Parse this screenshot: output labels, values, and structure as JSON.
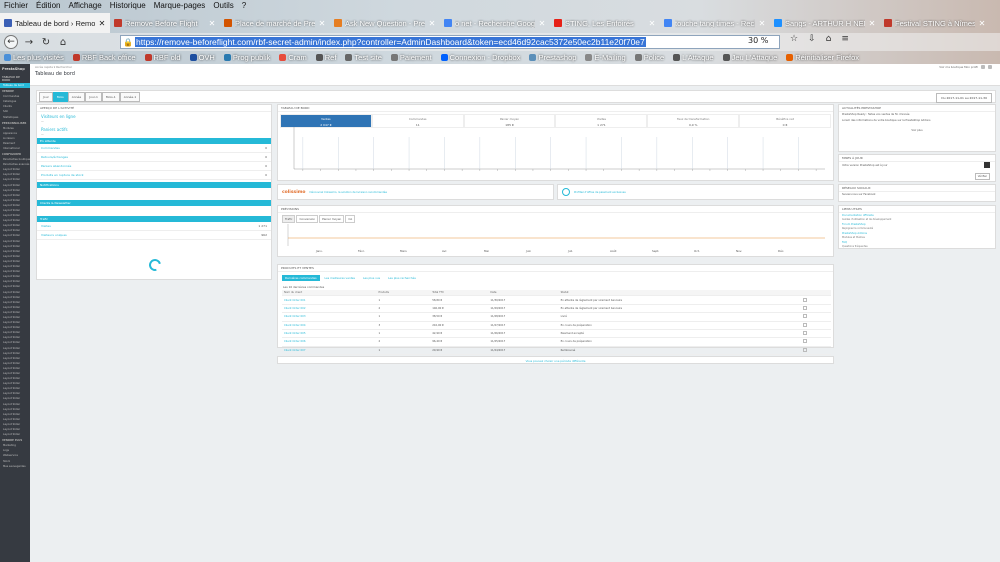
{
  "browser": {
    "menu": [
      "Fichier",
      "Édition",
      "Affichage",
      "Historique",
      "Marque-pages",
      "Outils",
      "?"
    ],
    "tabs": [
      {
        "title": "Tableau de bord › Remove",
        "color": "#3b5fb5",
        "active": true
      },
      {
        "title": "Remove Before Flight",
        "color": "#c0392b",
        "active": false
      },
      {
        "title": "Place de marché de Presta",
        "color": "#d35400",
        "active": false
      },
      {
        "title": "Ask New Question - Presta",
        "color": "#e67e22",
        "active": false
      },
      {
        "title": "o net - Recherche Google",
        "color": "#4285f4",
        "active": false
      },
      {
        "title": "STING, Les Enfoirés",
        "color": "#e62117",
        "active": false
      },
      {
        "title": "touche tang times - Rech",
        "color": "#4285f4",
        "active": false
      },
      {
        "title": "Sangs - ARTHUR H NEMO",
        "color": "#1e90ff",
        "active": false
      },
      {
        "title": "Festival STING à Nîmes",
        "color": "#c0392b",
        "active": false
      }
    ],
    "url": "https://remove-beforeflight.com/rbf-secret-admin/index.php?controller=AdminDashboard&token=ecd46d92cac5372e50ec2b11e20f70e7",
    "zoom": "30 %",
    "bookmarks": [
      {
        "label": "Les plus visités",
        "color": "#4a90d9"
      },
      {
        "label": "RBF Back office",
        "color": "#c0392b"
      },
      {
        "label": "RBF old",
        "color": "#c0392b"
      },
      {
        "label": "OVH",
        "color": "#1e4fa0"
      },
      {
        "label": "Prog publik",
        "color": "#2a7ab0"
      },
      {
        "label": "Cram",
        "color": "#e74c3c"
      },
      {
        "label": "Ref",
        "color": "#555"
      },
      {
        "label": "Test site",
        "color": "#666"
      },
      {
        "label": "Paiement",
        "color": "#777"
      },
      {
        "label": "Connexion - Dropbox",
        "color": "#0061fe"
      },
      {
        "label": "Prestashop",
        "color": "#5b8fb9"
      },
      {
        "label": "E-Mailing",
        "color": "#888"
      },
      {
        "label": "Police",
        "color": "#777"
      },
      {
        "label": "L'Attaque",
        "color": "#555"
      },
      {
        "label": "Jeu L'Attaque",
        "color": "#555"
      },
      {
        "label": "Réinitialiser Firefox",
        "color": "#e66000"
      }
    ]
  },
  "admin": {
    "logo": "PrestaShop",
    "breadcrumb": "Accès rapide ▾   Rechercher",
    "page_title": "Tableau de bord",
    "header_right": "Voir ma boutique   Mon profil",
    "sidebar": {
      "sections": [
        {
          "head": "Tableau de bord",
          "items": [
            "Tableau de bord"
          ]
        },
        {
          "head": "Vendre",
          "items": [
            "Commandes",
            "Catalogue",
            "Clients",
            "SAV",
            "Statistiques"
          ]
        },
        {
          "head": "Personnaliser",
          "items": [
            "Modules",
            "Apparence",
            "Livraison",
            "Paiement",
            "International"
          ]
        },
        {
          "head": "Configurer",
          "items": [
            "Paramètres boutique",
            "Paramètres avancés",
            "Layout Slider",
            "Layout Slider",
            "Layout Slider",
            "Layout Slider",
            "Layout Slider",
            "Layout Slider",
            "Layout Slider",
            "Layout Slider",
            "Layout Slider",
            "Layout Slider",
            "Layout Slider",
            "Layout Slider",
            "Layout Slider",
            "Layout Slider",
            "Layout Slider",
            "Layout Slider",
            "Layout Slider",
            "Layout Slider",
            "Layout Slider",
            "Layout Slider",
            "Layout Slider",
            "Layout Slider",
            "Layout Slider",
            "Layout Slider",
            "Layout Slider",
            "Layout Slider",
            "Layout Slider",
            "Layout Slider",
            "Layout Slider",
            "Layout Slider",
            "Layout Slider",
            "Layout Slider",
            "Layout Slider",
            "Layout Slider",
            "Layout Slider",
            "Layout Slider",
            "Layout Slider",
            "Layout Slider",
            "Layout Slider",
            "Layout Slider",
            "Layout Slider",
            "Layout Slider",
            "Layout Slider",
            "Layout Slider",
            "Layout Slider",
            "Layout Slider",
            "Layout Slider",
            "Layout Slider",
            "Layout Slider",
            "Layout Slider",
            "Layout Slider",
            "Layout Slider",
            "Layout Slider"
          ]
        },
        {
          "head": "Vendre plus",
          "items": [
            "Marketing",
            "Logs",
            "Webservice",
            "Stock",
            "Mes sauvegardes"
          ]
        }
      ]
    },
    "filter": {
      "periods": [
        "Jour",
        "Mois",
        "Année",
        "Jour-1",
        "Mois-1",
        "Année-1"
      ],
      "active": "Mois",
      "date_range": "Du 2017-11-01 au 2017-11-30"
    },
    "activity": {
      "title": "Aperçu de l'activité",
      "online_label": "Visiteurs en ligne",
      "active_label": "Paniers actifs",
      "sections": [
        "En attente",
        "Commandes",
        "Retours/échanges",
        "Paniers abandonnés",
        "Produits en rupture de stock"
      ],
      "notif": "Notifications",
      "clients": "Clients & Newsletter",
      "traffic": "Trafic",
      "rows": [
        {
          "label": "Visites",
          "value": "1 271"
        },
        {
          "label": "Visiteurs uniques",
          "value": "962"
        }
      ]
    },
    "dashgoals": {
      "title": "Tableau de bord",
      "kpis": [
        {
          "label": "Ventes",
          "value": "2 047 €"
        },
        {
          "label": "Commandes",
          "value": "11"
        },
        {
          "label": "Panier moyen",
          "value": "185 €"
        },
        {
          "label": "Visites",
          "value": "1 271"
        },
        {
          "label": "Taux de transformation",
          "value": "0,9 %"
        },
        {
          "label": "Bénéfice net",
          "value": "0 €"
        }
      ]
    },
    "partners": {
      "one_logo": "colissimo",
      "one_text": "Découvrez Colissimo, la solution de livraison recommandée",
      "two_text": "Profitez d'offres de paiement exclusives"
    },
    "perf": {
      "title": "Prévisions",
      "tabs": [
        "Trafic",
        "Conversion",
        "Panier moyen",
        "CA"
      ],
      "months": [
        "Janv.",
        "Févr.",
        "Mars",
        "Avr.",
        "Mai",
        "Juin",
        "Juil.",
        "Août",
        "Sept.",
        "Oct.",
        "Nov.",
        "Déc."
      ]
    },
    "products": {
      "title": "Produits et ventes",
      "tabs": [
        "Dernières commandes",
        "Les meilleures ventes",
        "Les plus vus",
        "Les plus recherchés"
      ],
      "table_title": "Les 10 dernières commandes",
      "headers": [
        "Nom du client",
        "Produits",
        "Total TTC",
        "Date",
        "Statut",
        ""
      ],
      "rows": [
        [
          "Client Order 001",
          "1",
          "58,80 €",
          "11/30/2017",
          "En attente de règlement par virement bancaire"
        ],
        [
          "Client Order 002",
          "2",
          "140,00 €",
          "11/29/2017",
          "En attente de règlement par virement bancaire"
        ],
        [
          "Client Order 003",
          "1",
          "38,50 €",
          "11/28/2017",
          "Livré"
        ],
        [
          "Client Order 004",
          "3",
          "210,00 €",
          "11/27/2017",
          "En cours de préparation"
        ],
        [
          "Client Order 005",
          "1",
          "42,90 €",
          "11/26/2017",
          "Paiement accepté"
        ],
        [
          "Client Order 006",
          "2",
          "96,40 €",
          "11/25/2017",
          "En cours de préparation"
        ],
        [
          "Client Order 007",
          "1",
          "29,90 €",
          "11/24/2017",
          "Remboursé"
        ]
      ],
      "footer": "Vous pouvez choisir une période différente"
    },
    "news": {
      "title": "Actualités PrestaShop",
      "text1": "PrestaShop Ready : faites vos ventes de fin d'année",
      "text2": "Lorem des informations de votre boutique sur la PrestaShop Addons",
      "link": "Voir plus"
    },
    "upd": {
      "title": "Mises à jour",
      "text": "Votre version PrestaShop est à jour",
      "button": "Vérifier"
    },
    "social": {
      "title": "Réseaux sociaux",
      "text": "Suivez-nous sur Facebook"
    },
    "links": {
      "title": "Liens utiles",
      "items": [
        {
          "l": "Documentation officielle",
          "d": "Guides d'utilisation et de développement"
        },
        {
          "l": "Forum PrestaShop",
          "d": "Rejoignez la communauté"
        },
        {
          "l": "PrestaShop Addons",
          "d": "Modules et thèmes"
        },
        {
          "l": "FAQ",
          "d": "Questions fréquentes"
        }
      ]
    }
  }
}
